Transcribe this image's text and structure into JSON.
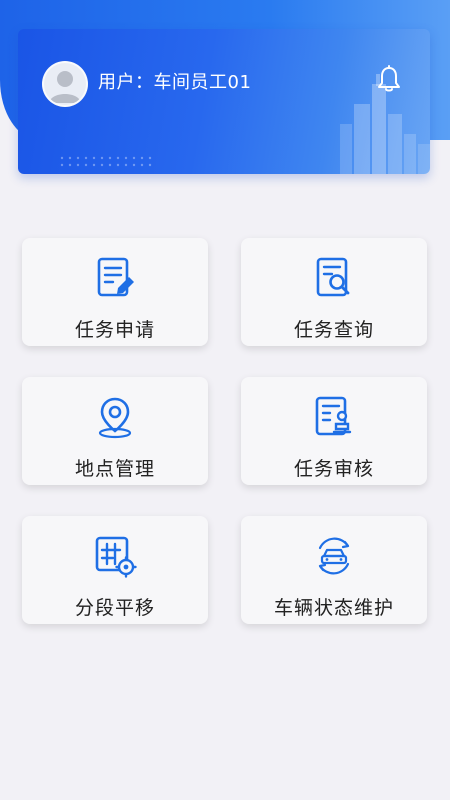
{
  "header": {
    "user_label": "用户：车间员工01"
  },
  "menu": [
    {
      "label": "任务申请",
      "icon": "edit-document-icon"
    },
    {
      "label": "任务查询",
      "icon": "search-document-icon"
    },
    {
      "label": "地点管理",
      "icon": "location-pin-icon"
    },
    {
      "label": "任务审核",
      "icon": "audit-document-icon"
    },
    {
      "label": "分段平移",
      "icon": "grid-gear-icon"
    },
    {
      "label": "车辆状态维护",
      "icon": "car-refresh-icon"
    }
  ],
  "colors": {
    "accent": "#1f6fe5",
    "header_start": "#1a55e6",
    "header_end": "#6aa6f4",
    "background": "#f2f1f6"
  }
}
